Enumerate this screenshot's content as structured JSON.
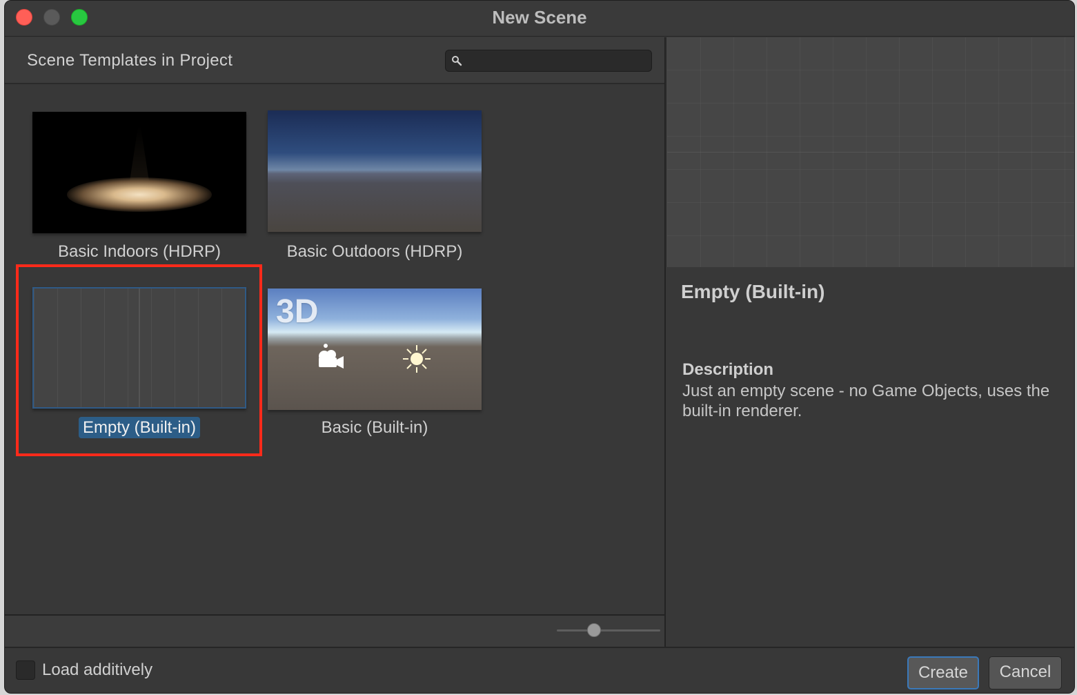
{
  "window": {
    "title": "New Scene"
  },
  "left_panel": {
    "header_title": "Scene Templates in Project",
    "search": {
      "value": "",
      "placeholder": ""
    },
    "templates": [
      {
        "label": "Basic Indoors (HDRP)",
        "selected": false
      },
      {
        "label": "Basic Outdoors (HDRP)",
        "selected": false
      },
      {
        "label": "Empty (Built-in)",
        "selected": true
      },
      {
        "label": "Basic (Built-in)",
        "selected": false,
        "thumb_text": "3D"
      }
    ],
    "zoom_slider": {
      "value_fraction": 0.36
    }
  },
  "details": {
    "title": "Empty (Built-in)",
    "description_heading": "Description",
    "description": "Just an empty scene - no Game Objects, uses the built-in renderer."
  },
  "footer": {
    "load_additively_label": "Load additively",
    "load_additively_checked": false,
    "create_label": "Create",
    "cancel_label": "Cancel"
  },
  "colors": {
    "selection_highlight": "#ff2a1a",
    "selected_label_bg": "#2c5d87",
    "primary_button_border": "#3a79bb"
  }
}
